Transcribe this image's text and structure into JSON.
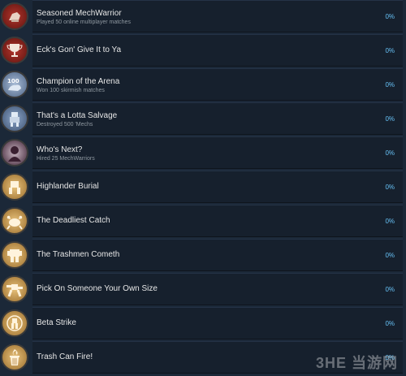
{
  "colors": {
    "page_bg": "#1b2838",
    "row_bg": "#16202d",
    "title": "#e6e6e6",
    "description": "#8f98a0",
    "percent": "#66c0f4",
    "badge_red": "#8b1e1a",
    "badge_blue": "#6d86a8",
    "badge_purple": "#4b2a40",
    "badge_gold": "#c79a4a"
  },
  "achievements": [
    {
      "title": "Seasoned MechWarrior",
      "description": "Played 50 online multiplayer matches",
      "percent": "0%",
      "icon": "mech-arm-icon",
      "badge": "red"
    },
    {
      "title": "Eck's Gon' Give It to Ya",
      "description": "",
      "percent": "0%",
      "icon": "trophy-icon",
      "badge": "red"
    },
    {
      "title": "Champion of the Arena",
      "description": "Won 100 skirmish matches",
      "percent": "0%",
      "icon": "flexing-arm-100-icon",
      "badge": "blue"
    },
    {
      "title": "That's a Lotta Salvage",
      "description": "Destroyed 500 'Mechs",
      "percent": "0%",
      "icon": "salvage-mech-icon",
      "badge": "blue"
    },
    {
      "title": "Who's Next?",
      "description": "Hired 25 MechWarriors",
      "percent": "0%",
      "icon": "pilot-silhouette-icon",
      "badge": "purple"
    },
    {
      "title": "Highlander Burial",
      "description": "",
      "percent": "0%",
      "icon": "mech-stomp-icon",
      "badge": "gold"
    },
    {
      "title": "The Deadliest Catch",
      "description": "",
      "percent": "0%",
      "icon": "crab-mech-icon",
      "badge": "gold"
    },
    {
      "title": "The Trashmen Cometh",
      "description": "",
      "percent": "0%",
      "icon": "trash-mech-icon",
      "badge": "gold"
    },
    {
      "title": "Pick On Someone Your Own Size",
      "description": "",
      "percent": "0%",
      "icon": "punching-mech-icon",
      "badge": "gold"
    },
    {
      "title": "Beta Strike",
      "description": "",
      "percent": "0%",
      "icon": "beta-strike-mech-icon",
      "badge": "gold"
    },
    {
      "title": "Trash Can Fire!",
      "description": "",
      "percent": "0%",
      "icon": "trash-can-fire-icon",
      "badge": "gold"
    }
  ],
  "watermark": "3HE 当游网"
}
